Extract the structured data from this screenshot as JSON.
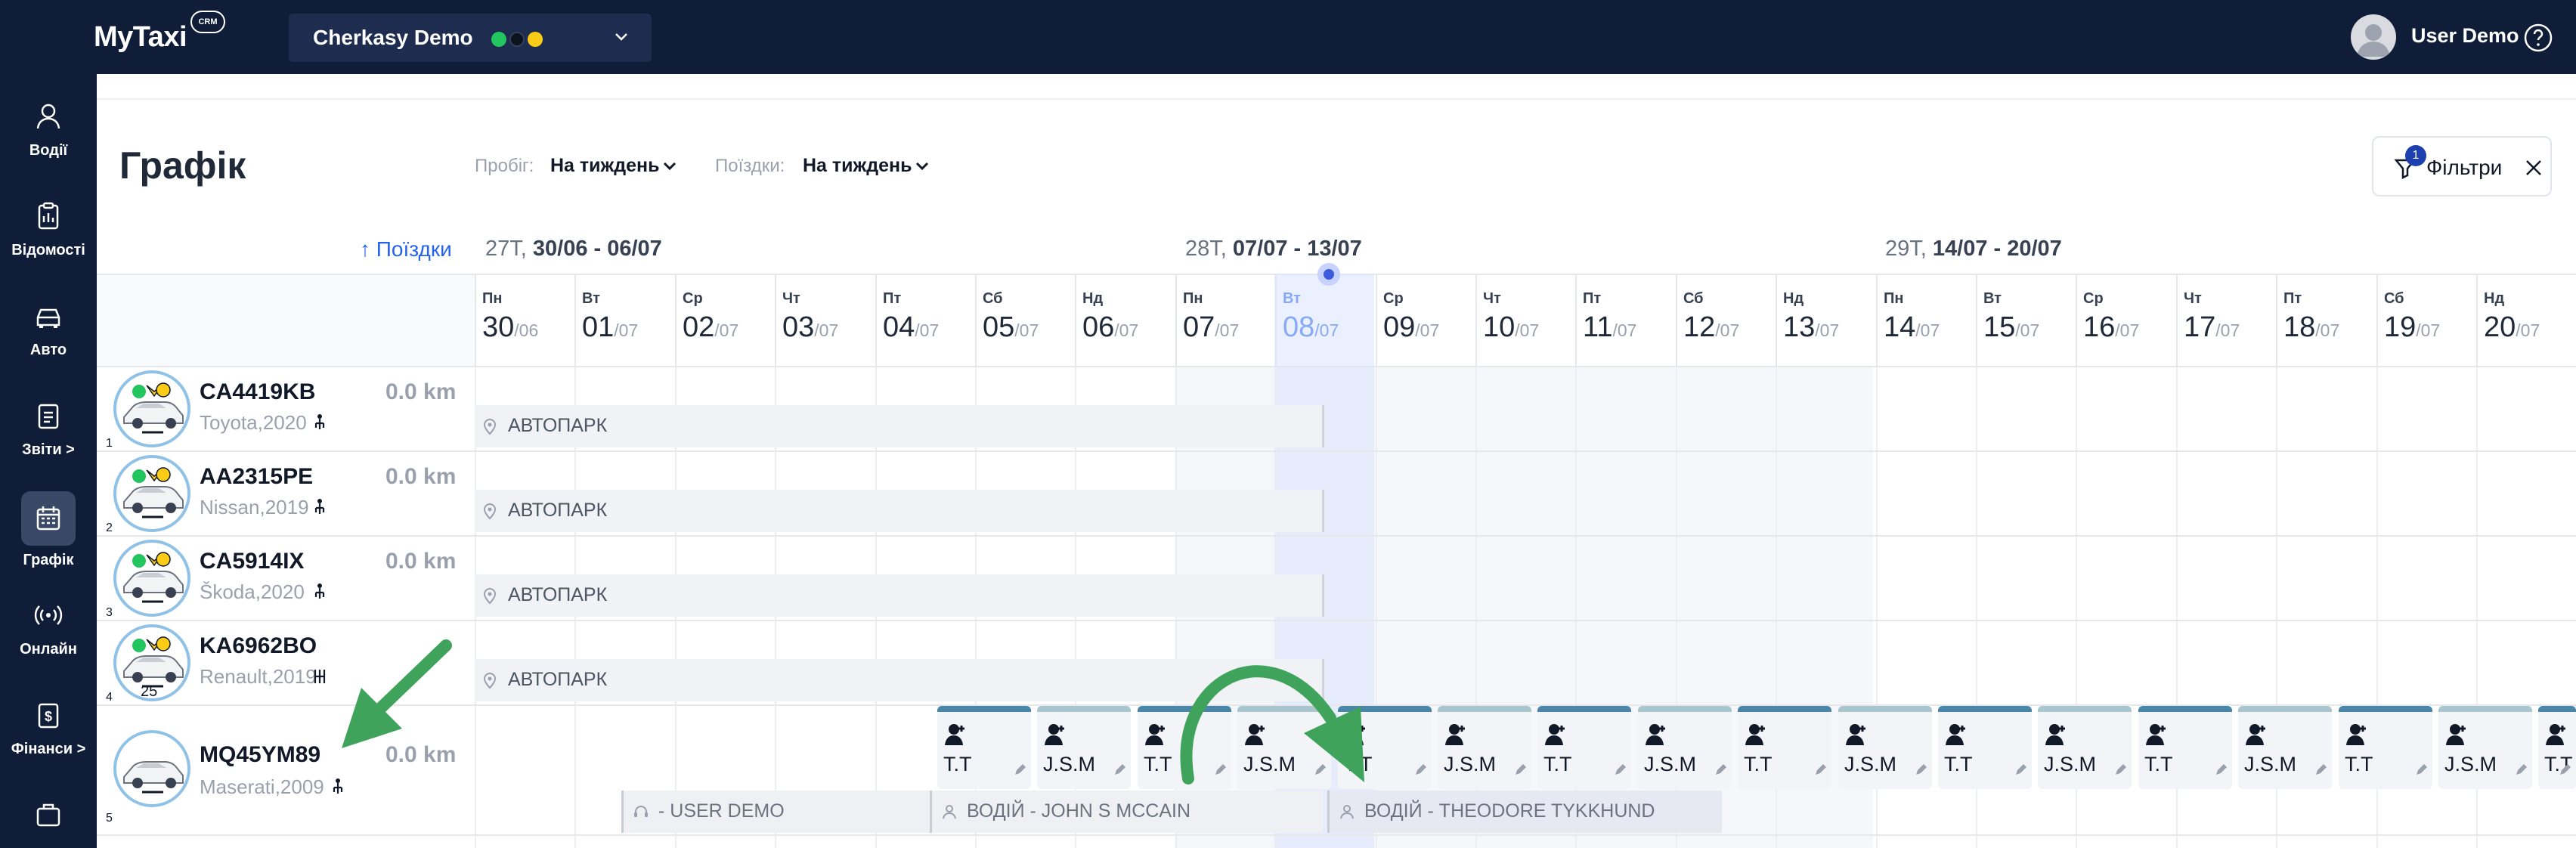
{
  "app": {
    "logo": "MyTaxi",
    "logo_badge": "CRM"
  },
  "header": {
    "city": "Cherkasy Demo",
    "city_status_colors": [
      "#22c55e",
      "#111827",
      "#facc15"
    ],
    "user_name": "User Demo"
  },
  "sidebar": {
    "items": [
      {
        "label": "Водії",
        "icon": "person-icon"
      },
      {
        "label": "Відомості",
        "icon": "clipboard-icon"
      },
      {
        "label": "Авто",
        "icon": "car-icon"
      },
      {
        "label": "Звіти >",
        "icon": "report-icon"
      },
      {
        "label": "Графік",
        "icon": "calendar-icon",
        "active": true
      },
      {
        "label": "Онлайн",
        "icon": "broadcast-icon"
      },
      {
        "label": "Фінанси >",
        "icon": "finance-icon"
      },
      {
        "label": "",
        "icon": "briefcase-icon"
      }
    ]
  },
  "page": {
    "title": "Графік",
    "mileage_label": "Пробіг:",
    "mileage_value": "На тиждень",
    "trips_label": "Поїздки:",
    "trips_value": "На тиждень",
    "filters_label": "Фільтри",
    "filters_count": "1",
    "sort_label": "↑ Поїздки"
  },
  "weeks": [
    {
      "num": "27Т,",
      "range": "30/06 - 06/07"
    },
    {
      "num": "28Т,",
      "range": "07/07 - 13/07"
    },
    {
      "num": "29Т,",
      "range": "14/07 - 20/07"
    }
  ],
  "days": [
    {
      "name": "Пн",
      "day": "30",
      "month": "/06"
    },
    {
      "name": "Вт",
      "day": "01",
      "month": "/07"
    },
    {
      "name": "Ср",
      "day": "02",
      "month": "/07"
    },
    {
      "name": "Чт",
      "day": "03",
      "month": "/07"
    },
    {
      "name": "Пт",
      "day": "04",
      "month": "/07"
    },
    {
      "name": "Сб",
      "day": "05",
      "month": "/07"
    },
    {
      "name": "Нд",
      "day": "06",
      "month": "/07"
    },
    {
      "name": "Пн",
      "day": "07",
      "month": "/07"
    },
    {
      "name": "Вт",
      "day": "08",
      "month": "/07",
      "today": true
    },
    {
      "name": "Ср",
      "day": "09",
      "month": "/07"
    },
    {
      "name": "Чт",
      "day": "10",
      "month": "/07"
    },
    {
      "name": "Пт",
      "day": "11",
      "month": "/07"
    },
    {
      "name": "Сб",
      "day": "12",
      "month": "/07"
    },
    {
      "name": "Нд",
      "day": "13",
      "month": "/07"
    },
    {
      "name": "Пн",
      "day": "14",
      "month": "/07"
    },
    {
      "name": "Вт",
      "day": "15",
      "month": "/07"
    },
    {
      "name": "Ср",
      "day": "16",
      "month": "/07"
    },
    {
      "name": "Чт",
      "day": "17",
      "month": "/07"
    },
    {
      "name": "Пт",
      "day": "18",
      "month": "/07"
    },
    {
      "name": "Сб",
      "day": "19",
      "month": "/07"
    },
    {
      "name": "Нд",
      "day": "20",
      "month": "/07"
    }
  ],
  "cars": [
    {
      "index": "1",
      "plate": "CA4419KB",
      "km": "0.0 km",
      "model": "Toyota,2020",
      "transmission": "manual"
    },
    {
      "index": "2",
      "plate": "AA2315PE",
      "km": "0.0 km",
      "model": "Nissan,2019",
      "transmission": "manual"
    },
    {
      "index": "3",
      "plate": "CA5914IX",
      "km": "0.0 km",
      "model": "Škoda,2020",
      "transmission": "manual"
    },
    {
      "index": "4",
      "plate": "KA6962BO",
      "km": "",
      "model": "Renault,2019",
      "transmission": "automatic",
      "badge": "25"
    },
    {
      "index": "5",
      "plate": "MQ45YM89",
      "km": "0.0 km",
      "model": "Maserati,2009",
      "transmission": "manual"
    }
  ],
  "park_label": "АВТОПАРК",
  "shifts": [
    "T.T",
    "J.S.M",
    "T.T",
    "J.S.M",
    "T.T",
    "J.S.M",
    "T.T",
    "J.S.M",
    "T.T",
    "J.S.M",
    "T.T",
    "J.S.M",
    "T.T",
    "J.S.M",
    "T.T",
    "J.S.M",
    "T.T"
  ],
  "assignments": [
    {
      "text": "-  USER DEMO",
      "icon": "headset-icon"
    },
    {
      "text": "ВОДІЙ  -  JOHN S MCCAIN",
      "icon": "person-icon"
    },
    {
      "text": "ВОДІЙ  -   THEODORE TYKKHUND",
      "icon": "person-icon"
    }
  ]
}
